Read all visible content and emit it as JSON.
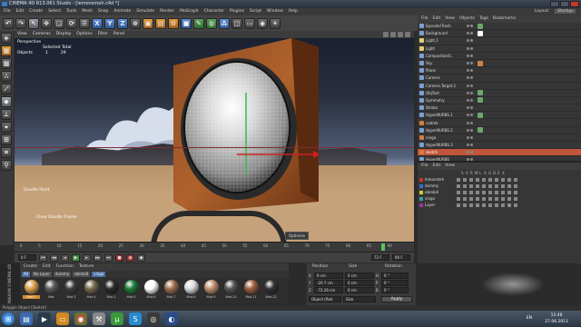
{
  "window": {
    "title": "CINEMA 4D R13.061 Studio - [lemonsmeh.c4d *]"
  },
  "menubar": [
    "File",
    "Edit",
    "Create",
    "Select",
    "Tools",
    "Mesh",
    "Snap",
    "Animate",
    "Simulate",
    "Render",
    "MoGraph",
    "Character",
    "Plugins",
    "Script",
    "Window",
    "Help"
  ],
  "layout": {
    "label": "Layout:",
    "value": "Startup"
  },
  "viewport": {
    "menu": [
      "View",
      "Cameras",
      "Display",
      "Options",
      "Filter",
      "Panel"
    ],
    "name": "Perspective",
    "selected_total_label": "Selected Total",
    "objects_label": "Objects",
    "objects_selected": "1",
    "objects_total": "29",
    "doodle_paint": "Doodle Paint",
    "clear_doodle": "Clear Doodle Frame",
    "optimize_button": "Optimize"
  },
  "timeline": {
    "ticks": [
      "0",
      "5",
      "10",
      "15",
      "20",
      "25",
      "30",
      "35",
      "40",
      "45",
      "50",
      "55",
      "60",
      "65",
      "70",
      "75",
      "80",
      "85",
      "90"
    ],
    "current_frame": "72 F",
    "start_field": "0 F",
    "end_field": "90 F"
  },
  "materials": {
    "menu": [
      "Create",
      "Edit",
      "Function",
      "Texture"
    ],
    "filters": [
      {
        "label": "All",
        "on": true
      },
      {
        "label": "No Layer",
        "on": false
      },
      {
        "label": "dummy",
        "on": false
      },
      {
        "label": "obrobi4",
        "on": false
      },
      {
        "label": "vinga",
        "on": true
      }
    ],
    "items": [
      {
        "label": "Mat 2",
        "color": "#d9a050",
        "selected": true
      },
      {
        "label": "Mat",
        "color": "#5a5a5a",
        "selected": false
      },
      {
        "label": "Mat.3",
        "color": "#3c3c3c",
        "selected": false
      },
      {
        "label": "Mat.4",
        "color": "#7a6a50",
        "selected": false
      },
      {
        "label": "Mat.1",
        "color": "#2a2a2a",
        "selected": false
      },
      {
        "label": "Mat.5",
        "color": "#1e7a3a",
        "selected": false
      },
      {
        "label": "Mat.6",
        "color": "#ffffff",
        "selected": false
      },
      {
        "label": "Mat.7",
        "color": "#a07050",
        "selected": false
      },
      {
        "label": "Mat.8",
        "color": "#dddddd",
        "selected": false
      },
      {
        "label": "Mat.9",
        "color": "#c09070",
        "selected": false
      },
      {
        "label": "Mat.10",
        "color": "#555555",
        "selected": false
      },
      {
        "label": "Mat.11",
        "color": "#9c6040",
        "selected": false
      },
      {
        "label": "Mat.12",
        "color": "#333333",
        "selected": false
      }
    ]
  },
  "coordinates": {
    "headers": [
      "Position",
      "Size",
      "Rotation"
    ],
    "rows": [
      {
        "axis": "X",
        "pos": "0 cm",
        "size": "0 cm",
        "rot_label": "H",
        "rot": "0 °"
      },
      {
        "axis": "Y",
        "pos": "-20.7 cm",
        "size": "0 cm",
        "rot_label": "P",
        "rot": "0 °"
      },
      {
        "axis": "Z",
        "pos": "-72.26 cm",
        "size": "0 cm",
        "rot_label": "B",
        "rot": "0 °"
      }
    ],
    "mode": "Object (Rel)",
    "size_mode": "Size",
    "apply": "Apply"
  },
  "object_manager": {
    "menu": [
      "File",
      "Edit",
      "View",
      "Objects",
      "Tags",
      "Bookmarks"
    ],
    "objects": [
      {
        "name": "Episode/Trash",
        "icon": "#7aa0d4",
        "tag": "#6aa86a",
        "hl": false
      },
      {
        "name": "Background",
        "icon": "#7aa0d4",
        "tag": "#ffffff",
        "hl": false
      },
      {
        "name": "Light.1",
        "icon": "#e0d070",
        "tag": "",
        "hl": false
      },
      {
        "name": "Light",
        "icon": "#e0d070",
        "tag": "",
        "hl": false
      },
      {
        "name": "CompositionS..",
        "icon": "#7aa0d4",
        "tag": "",
        "hl": false
      },
      {
        "name": "Sky",
        "icon": "#7aa0d4",
        "tag": "#d08040",
        "hl": false
      },
      {
        "name": "Plane",
        "icon": "#7aa0d4",
        "tag": "",
        "hl": false
      },
      {
        "name": "Camera",
        "icon": "#7aa0d4",
        "tag": "",
        "hl": false
      },
      {
        "name": "Camera.Target.1",
        "icon": "#7aa0d4",
        "tag": "",
        "hl": false
      },
      {
        "name": "ObjText",
        "icon": "#7aa0d4",
        "tag": "#6aa86a",
        "hl": false
      },
      {
        "name": "Symmetry",
        "icon": "#7aa0d4",
        "tag": "#6aa86a",
        "hl": false
      },
      {
        "name": "Strobo",
        "icon": "#7aa0d4",
        "tag": "",
        "hl": false
      },
      {
        "name": "HyperNURBS.1",
        "icon": "#7aa0d4",
        "tag": "#6aa86a",
        "hl": false
      },
      {
        "name": "cadrek",
        "icon": "#d08040",
        "tag": "",
        "hl": false
      },
      {
        "name": "HyperNURBS.2",
        "icon": "#7aa0d4",
        "tag": "#6aa86a",
        "hl": false
      },
      {
        "name": "ninga",
        "icon": "#d08040",
        "tag": "",
        "hl": false
      },
      {
        "name": "HyperNURBS.3",
        "icon": "#7aa0d4",
        "tag": "",
        "hl": false
      },
      {
        "name": "sketch",
        "icon": "#d08040",
        "tag": "",
        "hl": true
      },
      {
        "name": "HyperNURBS",
        "icon": "#7aa0d4",
        "tag": "",
        "hl": false
      }
    ]
  },
  "attribute_manager": {
    "menu": [
      "File",
      "Edit",
      "View"
    ],
    "cols": [
      "S",
      "V",
      "R",
      "M",
      "L",
      "A",
      "G",
      "D",
      "E",
      "X"
    ],
    "layers": [
      {
        "name": "lemonsteh",
        "color": "#d03030"
      },
      {
        "name": "dummy",
        "color": "#3070d0"
      },
      {
        "name": "obrobi4",
        "color": "#d0d030"
      },
      {
        "name": "vinga",
        "color": "#30a0a0"
      },
      {
        "name": "Layer",
        "color": "#a030a0"
      }
    ]
  },
  "status": "Polygon Object [Sketch]",
  "taskbar": {
    "lang": "EN",
    "time": "11:46",
    "date": "27.06.2011"
  }
}
